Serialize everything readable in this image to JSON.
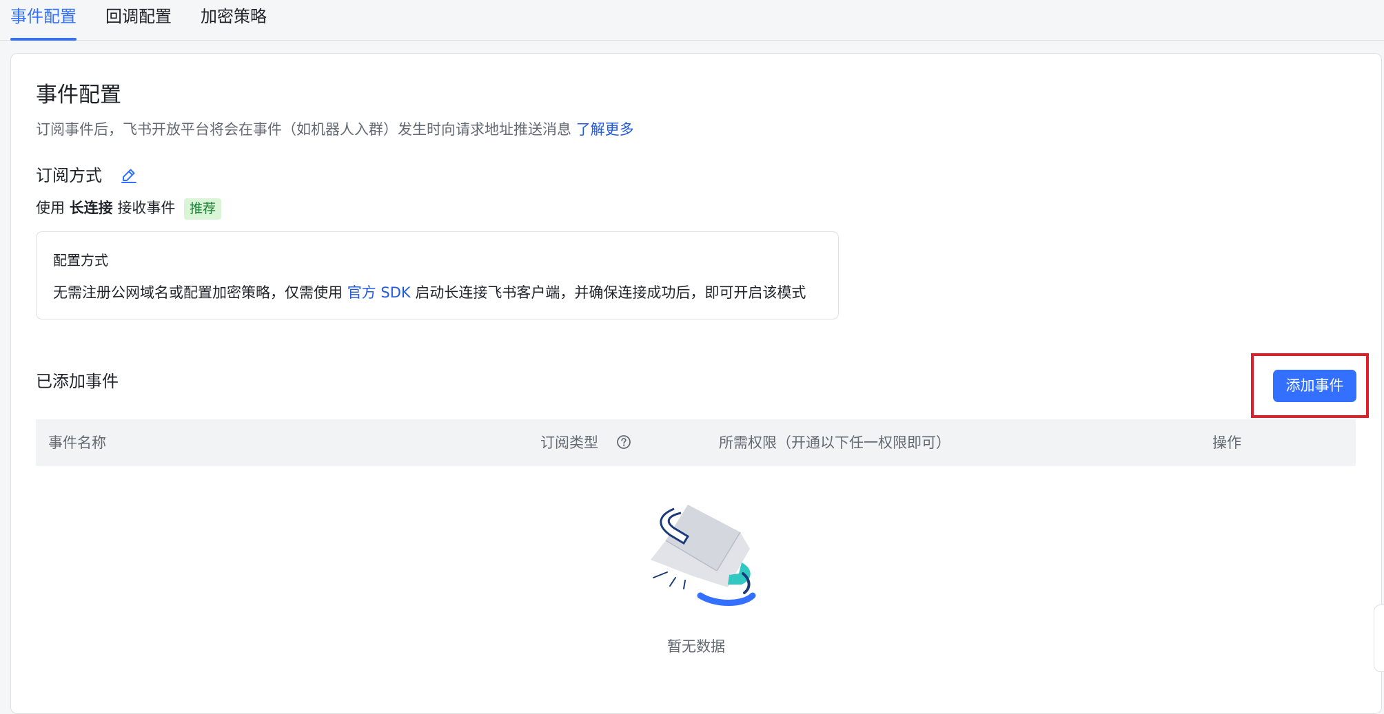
{
  "tabs": [
    {
      "label": "事件配置",
      "active": true
    },
    {
      "label": "回调配置",
      "active": false
    },
    {
      "label": "加密策略",
      "active": false
    }
  ],
  "page": {
    "title": "事件配置",
    "description": "订阅事件后，飞书开放平台将会在事件（如机器人入群）发生时向请求地址推送消息",
    "learn_more": "了解更多"
  },
  "subscription": {
    "title": "订阅方式",
    "edit_icon": "edit-icon",
    "mode_prefix": "使用",
    "mode_name": "长连接",
    "mode_suffix": "接收事件",
    "tag": "推荐"
  },
  "config": {
    "title": "配置方式",
    "text_before": "无需注册公网域名或配置加密策略，仅需使用",
    "sdk_link": "官方 SDK",
    "text_after": "启动长连接飞书客户端，并确保连接成功后，即可开启该模式"
  },
  "events": {
    "title": "已添加事件",
    "add_button": "添加事件",
    "columns": [
      "事件名称",
      "订阅类型",
      "所需权限（开通以下任一权限即可）",
      "操作"
    ],
    "help_icon": "question-circle-icon",
    "empty_text": "暂无数据"
  },
  "colors": {
    "accent": "#3370ff",
    "link": "#245bdb",
    "highlight": "#e21e2b",
    "tag_bg": "#d9f5d6",
    "tag_text": "#1a7f37"
  }
}
